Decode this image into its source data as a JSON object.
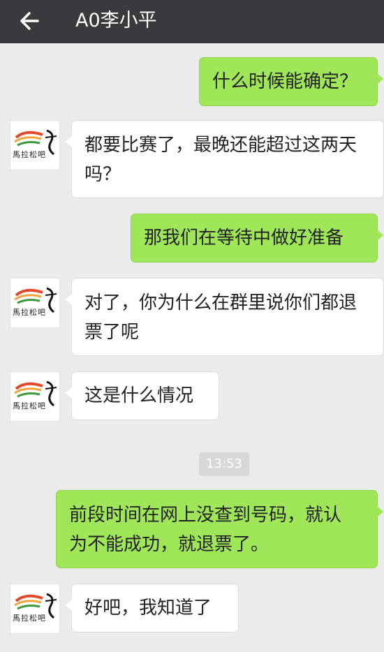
{
  "header": {
    "title": "A0李小平",
    "back_icon": "back-arrow-icon",
    "background": "#383a3e"
  },
  "avatar": {
    "text": "馬拉松吧",
    "icon": "marathon-bar-logo-icon"
  },
  "messages": [
    {
      "side": "right",
      "text": "什么时候能确定？"
    },
    {
      "side": "left",
      "line1": "都要比赛了，最晚还能超过这两天",
      "line2": "吗？"
    },
    {
      "side": "right",
      "text": "那我们在等待中做好准备"
    },
    {
      "side": "left",
      "line1": "对了，你为什么在群里说你们都退",
      "line2": "票了呢"
    },
    {
      "side": "left",
      "text": "这是什么情况"
    },
    {
      "side": "right",
      "line1": "前段时间在网上没查到号码，就认",
      "line2": "为不能成功，就退票了。"
    },
    {
      "side": "left",
      "text": "好吧，我知道了"
    }
  ],
  "timestamp": "13:53",
  "colors": {
    "sent_bubble": "#9fe658",
    "received_bubble": "#ffffff",
    "chat_background": "#ebebeb"
  }
}
